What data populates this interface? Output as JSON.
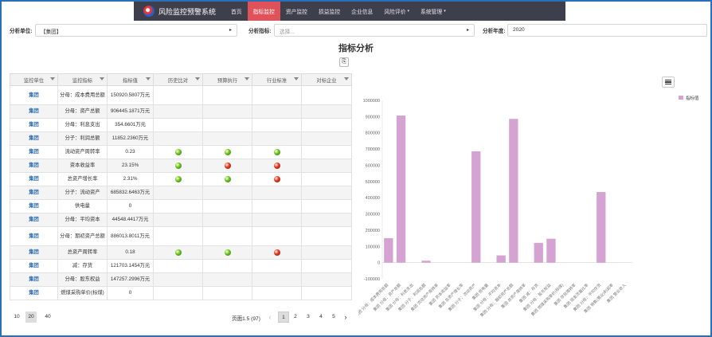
{
  "app": {
    "title": "风险监控预警系统",
    "nav": [
      {
        "label": "首页",
        "active": false,
        "dropdown": false
      },
      {
        "label": "指标监控",
        "active": true,
        "dropdown": false
      },
      {
        "label": "资产监控",
        "active": false,
        "dropdown": false
      },
      {
        "label": "损益监控",
        "active": false,
        "dropdown": false
      },
      {
        "label": "企业信息",
        "active": false,
        "dropdown": false
      },
      {
        "label": "风险评价",
        "active": false,
        "dropdown": true
      },
      {
        "label": "系统管理",
        "active": false,
        "dropdown": true
      }
    ]
  },
  "filters": {
    "unit_label": "分析单位:",
    "unit_value": "【集团】",
    "indicator_label": "分析指标:",
    "indicator_placeholder": "选择...",
    "year_label": "分析年度:",
    "year_value": "2020"
  },
  "page": {
    "title": "指标分析"
  },
  "table": {
    "headers": [
      "监控单位",
      "监控指标",
      "指标值",
      "历史比对",
      "预算执行",
      "行业标准",
      "对标企业"
    ],
    "rows": [
      {
        "unit": "集团",
        "indicator": "分母：成本费用总额",
        "value": "150920.5807万元",
        "hist": "",
        "budget": "",
        "industry": ""
      },
      {
        "unit": "集团",
        "indicator": "分母：资产总额",
        "value": "906445.1871万元",
        "hist": "",
        "budget": "",
        "industry": ""
      },
      {
        "unit": "集团",
        "indicator": "分母：利息支出",
        "value": "354.6601万元",
        "hist": "",
        "budget": "",
        "industry": ""
      },
      {
        "unit": "集团",
        "indicator": "分子：利润总额",
        "value": "11852.2360万元",
        "hist": "",
        "budget": "",
        "industry": ""
      },
      {
        "unit": "集团",
        "indicator": "流动资产周转率",
        "value": "0.23",
        "hist": "green",
        "budget": "green",
        "industry": "green"
      },
      {
        "unit": "集团",
        "indicator": "资本收益率",
        "value": "23.15%",
        "hist": "green",
        "budget": "red",
        "industry": "red"
      },
      {
        "unit": "集团",
        "indicator": "总资产增长率",
        "value": "2.31%",
        "hist": "green",
        "budget": "green",
        "industry": "red"
      },
      {
        "unit": "集团",
        "indicator": "分子：流动资产",
        "value": "685832.6463万元",
        "hist": "",
        "budget": "",
        "industry": ""
      },
      {
        "unit": "集团",
        "indicator": "供电量",
        "value": "0",
        "hist": "",
        "budget": "",
        "industry": ""
      },
      {
        "unit": "集团",
        "indicator": "分母：平均资本",
        "value": "44548.4417万元",
        "hist": "",
        "budget": "",
        "industry": ""
      },
      {
        "unit": "集团",
        "indicator": "分母：期初资产总额",
        "value": "886013.8011万元",
        "hist": "",
        "budget": "",
        "industry": ""
      },
      {
        "unit": "集团",
        "indicator": "总资产周转率",
        "value": "0.18",
        "hist": "green",
        "budget": "green",
        "industry": "red"
      },
      {
        "unit": "集团",
        "indicator": "减：存货",
        "value": "121703.1454万元",
        "hist": "",
        "budget": "",
        "industry": ""
      },
      {
        "unit": "集团",
        "indicator": "分母：股东权益",
        "value": "147257.2996万元",
        "hist": "",
        "budget": "",
        "industry": ""
      },
      {
        "unit": "集团",
        "indicator": "燃煤采购单价(标煤)",
        "value": "0",
        "hist": "",
        "budget": "",
        "industry": ""
      }
    ]
  },
  "pagination": {
    "page_sizes": [
      "10",
      "20",
      "40"
    ],
    "active_size": "20",
    "info": "页面1.5 (97)",
    "pages": [
      "1",
      "2",
      "3",
      "4",
      "5"
    ],
    "active_page": "1",
    "prev_icon": "chevron-left-icon",
    "next_icon": "chevron-right-icon"
  },
  "colors": {
    "nav_bg": "#3d3f4d",
    "nav_active": "#e0525a",
    "bar": "#d4a3d2",
    "frame": "#2b6fb6",
    "link": "#2a6bb5"
  },
  "chart_data": {
    "type": "bar",
    "legend": "指标值",
    "legend_position": "top-right",
    "ylim": [
      -100000,
      1000000
    ],
    "yticks": [
      -100000,
      0,
      100000,
      200000,
      300000,
      400000,
      500000,
      600000,
      700000,
      800000,
      900000,
      1000000
    ],
    "categories": [
      "集团 分母：成本费用总额",
      "集团 分母：资产总额",
      "集团 分母：利息支出",
      "集团 分子：利润总额",
      "集团 流动资产周转率",
      "集团 资本收益率",
      "集团 总资产增长率",
      "集团 分子：流动资产",
      "集团 供电量",
      "集团 分母：平均资本",
      "集团 分母：期初资产总额",
      "集团 总资产周转率",
      "集团 减：存货",
      "集团 分母：股东权益",
      "集团 燃煤采购单价(标煤)",
      "集团 存货周转率",
      "集团 现金流量比率",
      "集团 分母：平均存货",
      "集团 销售(营业)利润率",
      "集团 营业收入"
    ],
    "values": [
      150920.58,
      906445.19,
      354.66,
      11852.24,
      0.23,
      0.2315,
      0.0231,
      685832.65,
      0,
      44548.44,
      886013.8,
      0.18,
      121703.15,
      147257.3,
      0,
      0,
      0,
      435000,
      0,
      0
    ]
  }
}
